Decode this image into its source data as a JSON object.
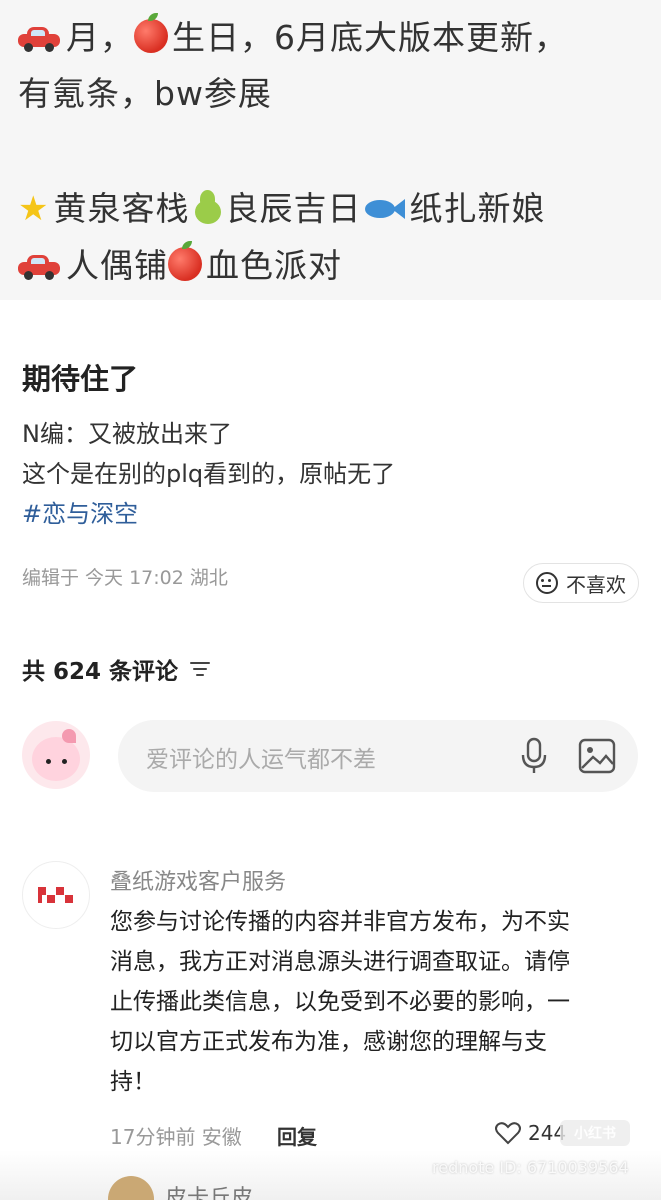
{
  "post_image": {
    "line1": "月，",
    "line1b": "生日，6月底大版本更新，",
    "line2": "有氪条，bw参展",
    "line3a": "黄泉客栈",
    "line3b": "良辰吉日",
    "line3c": "纸扎新娘",
    "line4a": "人偶铺",
    "line4b": "血色派对",
    "colors": {
      "car": "#e0413a",
      "apple": "#d92f22",
      "star": "#f5c518",
      "pear": "#9bcc49",
      "fish": "#3e8fd6"
    }
  },
  "post": {
    "title": "期待住了",
    "body_line1": "N编：又被放出来了",
    "body_line2": "这个是在别的plq看到的，原帖无了",
    "hashtag": "#恋与深空",
    "meta": "编辑于 今天 17:02 湖北",
    "dislike_label": "不喜欢"
  },
  "comments_header": {
    "count_label": "共 624 条评论"
  },
  "comment_input": {
    "placeholder": "爱评论的人运气都不差"
  },
  "comment": {
    "author": "叠纸游戏客户服务",
    "line1": "您参与讨论传播的内容并非官方发布，为不实",
    "line2": "消息，我方正对消息源头进行调查取证。请停",
    "line3": "止传播此类信息，以免受到不必要的影响，一",
    "line4": "切以官方正式发布为准，感谢您的理解与支",
    "line5": "持！",
    "meta": "17分钟前 安徽",
    "reply_label": "回复",
    "like_count": "244"
  },
  "next_comment": {
    "author": "皮卡丘皮"
  },
  "watermark": {
    "text": "rednote ID: 6710039564",
    "logo_text": "小红书"
  }
}
